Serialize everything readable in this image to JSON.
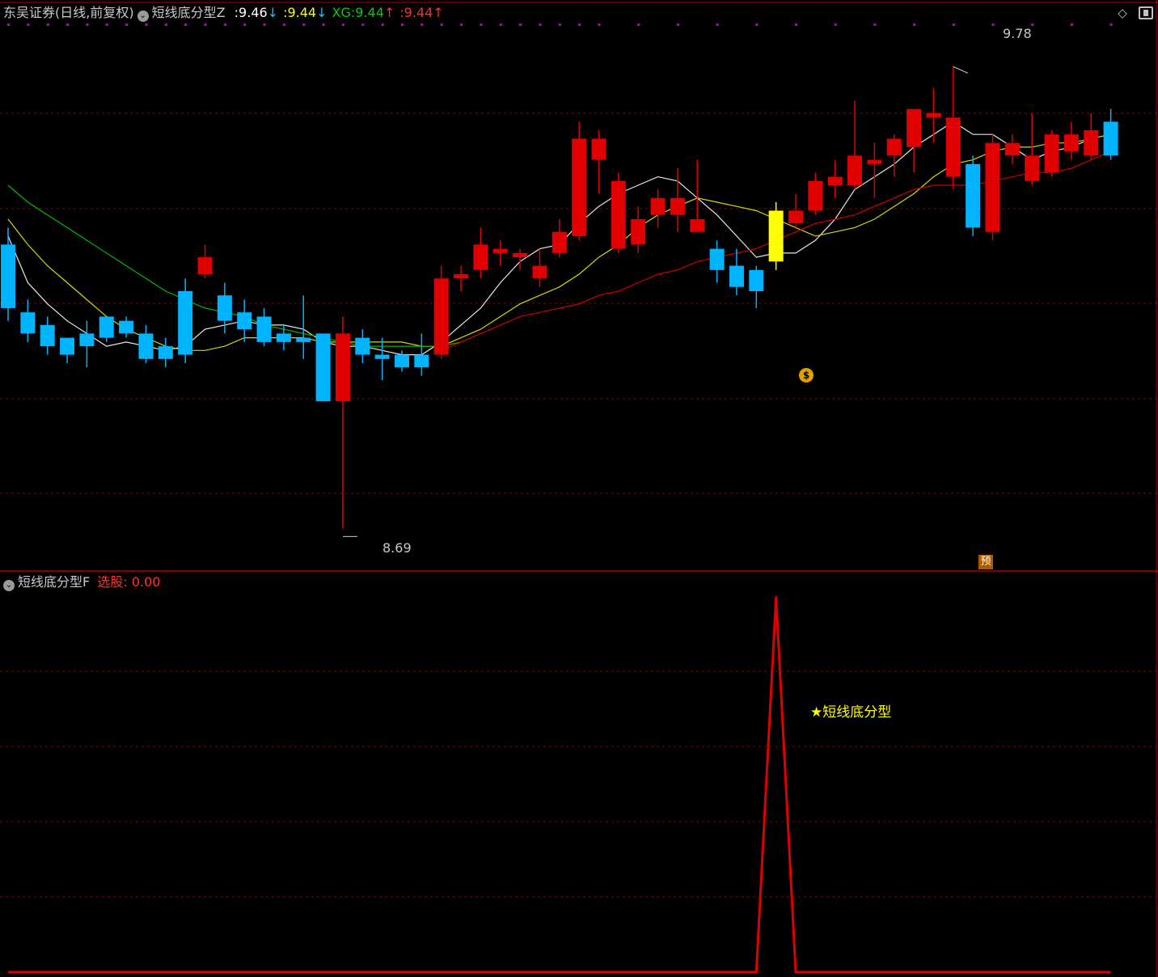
{
  "header": {
    "broker": "东吴证券",
    "period": "(日线,前复权)",
    "indicator_name": "短线底分型Z",
    "values": [
      {
        "label": ":",
        "value": "9.46",
        "arrow": "↓",
        "color": "#ffffff",
        "arrow_color": "#00c8ff"
      },
      {
        "label": ":",
        "value": "9.44",
        "arrow": "↓",
        "color": "#ffff00",
        "arrow_color": "#00c8ff"
      },
      {
        "label": "XG:",
        "value": "9.44",
        "arrow": "↑",
        "color": "#00d000",
        "arrow_color": "#ff3030"
      },
      {
        "label": ":",
        "value": "9.44",
        "arrow": "↑",
        "color": "#ff3030",
        "arrow_color": "#ff3030"
      }
    ],
    "chevron_icon": "chevron-down-icon",
    "diamond_icon": "diamond-icon",
    "window_icon": "maximize-icon"
  },
  "sub_header": {
    "indicator_name": "短线底分型F",
    "label": "选股",
    "value": "0.00"
  },
  "annotations": {
    "high_label": "9.78",
    "low_label": "8.69",
    "signal_text": "短线底分型",
    "star": "★",
    "yu_badge": "预",
    "money_bag": "$"
  },
  "colors": {
    "up": "#e00000",
    "down": "#00b4ff",
    "signal": "#ffff00",
    "ma_white": "#e8e8e8",
    "ma_yellow": "#d8d800",
    "ma_green": "#00b800",
    "ma_red": "#d00000",
    "grid": "#8a0000",
    "separator": "#b00000",
    "dots": "#c000c0"
  },
  "chart_data": [
    {
      "type": "candlestick",
      "title": "",
      "ylim": [
        8.62,
        9.88
      ],
      "high_marker": 9.78,
      "low_marker": 8.69,
      "bars": [
        {
          "o": 9.36,
          "h": 9.4,
          "l": 9.18,
          "c": 9.21,
          "s": "down"
        },
        {
          "o": 9.2,
          "h": 9.23,
          "l": 9.13,
          "c": 9.15,
          "s": "down"
        },
        {
          "o": 9.17,
          "h": 9.19,
          "l": 9.1,
          "c": 9.12,
          "s": "down"
        },
        {
          "o": 9.14,
          "h": 9.14,
          "l": 9.08,
          "c": 9.1,
          "s": "down"
        },
        {
          "o": 9.15,
          "h": 9.18,
          "l": 9.07,
          "c": 9.12,
          "s": "down"
        },
        {
          "o": 9.19,
          "h": 9.19,
          "l": 9.13,
          "c": 9.14,
          "s": "down"
        },
        {
          "o": 9.18,
          "h": 9.19,
          "l": 9.14,
          "c": 9.15,
          "s": "down"
        },
        {
          "o": 9.15,
          "h": 9.17,
          "l": 9.08,
          "c": 9.09,
          "s": "down"
        },
        {
          "o": 9.12,
          "h": 9.14,
          "l": 9.07,
          "c": 9.09,
          "s": "down"
        },
        {
          "o": 9.25,
          "h": 9.28,
          "l": 9.08,
          "c": 9.1,
          "s": "down"
        },
        {
          "o": 9.29,
          "h": 9.36,
          "l": 9.28,
          "c": 9.33,
          "s": "up"
        },
        {
          "o": 9.24,
          "h": 9.27,
          "l": 9.15,
          "c": 9.18,
          "s": "down"
        },
        {
          "o": 9.2,
          "h": 9.23,
          "l": 9.13,
          "c": 9.16,
          "s": "down"
        },
        {
          "o": 9.19,
          "h": 9.21,
          "l": 9.12,
          "c": 9.13,
          "s": "down"
        },
        {
          "o": 9.15,
          "h": 9.17,
          "l": 9.11,
          "c": 9.13,
          "s": "down"
        },
        {
          "o": 9.14,
          "h": 9.24,
          "l": 9.09,
          "c": 9.13,
          "s": "down"
        },
        {
          "o": 9.15,
          "h": 9.15,
          "l": 8.99,
          "c": 8.99,
          "s": "down"
        },
        {
          "o": 8.99,
          "h": 9.19,
          "l": 8.69,
          "c": 9.15,
          "s": "up"
        },
        {
          "o": 9.14,
          "h": 9.16,
          "l": 9.08,
          "c": 9.1,
          "s": "down"
        },
        {
          "o": 9.1,
          "h": 9.14,
          "l": 9.04,
          "c": 9.09,
          "s": "down"
        },
        {
          "o": 9.1,
          "h": 9.11,
          "l": 9.06,
          "c": 9.07,
          "s": "down"
        },
        {
          "o": 9.1,
          "h": 9.15,
          "l": 9.05,
          "c": 9.07,
          "s": "down"
        },
        {
          "o": 9.1,
          "h": 9.31,
          "l": 9.09,
          "c": 9.28,
          "s": "up"
        },
        {
          "o": 9.28,
          "h": 9.31,
          "l": 9.25,
          "c": 9.29,
          "s": "up"
        },
        {
          "o": 9.3,
          "h": 9.4,
          "l": 9.28,
          "c": 9.36,
          "s": "up"
        },
        {
          "o": 9.34,
          "h": 9.37,
          "l": 9.31,
          "c": 9.35,
          "s": "up"
        },
        {
          "o": 9.33,
          "h": 9.35,
          "l": 9.3,
          "c": 9.34,
          "s": "up"
        },
        {
          "o": 9.28,
          "h": 9.35,
          "l": 9.26,
          "c": 9.31,
          "s": "up"
        },
        {
          "o": 9.34,
          "h": 9.42,
          "l": 9.33,
          "c": 9.39,
          "s": "up"
        },
        {
          "o": 9.38,
          "h": 9.65,
          "l": 9.37,
          "c": 9.61,
          "s": "up"
        },
        {
          "o": 9.56,
          "h": 9.63,
          "l": 9.48,
          "c": 9.61,
          "s": "up"
        },
        {
          "o": 9.35,
          "h": 9.53,
          "l": 9.34,
          "c": 9.51,
          "s": "up"
        },
        {
          "o": 9.36,
          "h": 9.45,
          "l": 9.34,
          "c": 9.42,
          "s": "up"
        },
        {
          "o": 9.43,
          "h": 9.49,
          "l": 9.4,
          "c": 9.47,
          "s": "up"
        },
        {
          "o": 9.43,
          "h": 9.54,
          "l": 9.39,
          "c": 9.47,
          "s": "up"
        },
        {
          "o": 9.39,
          "h": 9.56,
          "l": 9.39,
          "c": 9.42,
          "s": "up"
        },
        {
          "o": 9.35,
          "h": 9.37,
          "l": 9.27,
          "c": 9.3,
          "s": "down"
        },
        {
          "o": 9.31,
          "h": 9.35,
          "l": 9.24,
          "c": 9.26,
          "s": "down"
        },
        {
          "o": 9.3,
          "h": 9.31,
          "l": 9.21,
          "c": 9.25,
          "s": "down"
        },
        {
          "o": 9.32,
          "h": 9.46,
          "l": 9.3,
          "c": 9.44,
          "s": "signal"
        },
        {
          "o": 9.41,
          "h": 9.48,
          "l": 9.4,
          "c": 9.44,
          "s": "up"
        },
        {
          "o": 9.44,
          "h": 9.53,
          "l": 9.43,
          "c": 9.51,
          "s": "up"
        },
        {
          "o": 9.5,
          "h": 9.56,
          "l": 9.47,
          "c": 9.52,
          "s": "up"
        },
        {
          "o": 9.5,
          "h": 9.7,
          "l": 9.49,
          "c": 9.57,
          "s": "up"
        },
        {
          "o": 9.55,
          "h": 9.6,
          "l": 9.47,
          "c": 9.56,
          "s": "up"
        },
        {
          "o": 9.57,
          "h": 9.62,
          "l": 9.52,
          "c": 9.61,
          "s": "up"
        },
        {
          "o": 9.59,
          "h": 9.68,
          "l": 9.53,
          "c": 9.68,
          "s": "up"
        },
        {
          "o": 9.66,
          "h": 9.73,
          "l": 9.6,
          "c": 9.67,
          "s": "up"
        },
        {
          "o": 9.52,
          "h": 9.78,
          "l": 9.49,
          "c": 9.66,
          "s": "up"
        },
        {
          "o": 9.55,
          "h": 9.57,
          "l": 9.38,
          "c": 9.4,
          "s": "down"
        },
        {
          "o": 9.39,
          "h": 9.62,
          "l": 9.37,
          "c": 9.6,
          "s": "up"
        },
        {
          "o": 9.57,
          "h": 9.62,
          "l": 9.55,
          "c": 9.6,
          "s": "up"
        },
        {
          "o": 9.51,
          "h": 9.67,
          "l": 9.5,
          "c": 9.57,
          "s": "up"
        },
        {
          "o": 9.53,
          "h": 9.63,
          "l": 9.52,
          "c": 9.62,
          "s": "up"
        },
        {
          "o": 9.58,
          "h": 9.65,
          "l": 9.56,
          "c": 9.62,
          "s": "up"
        },
        {
          "o": 9.57,
          "h": 9.67,
          "l": 9.56,
          "c": 9.63,
          "s": "up"
        },
        {
          "o": 9.57,
          "h": 9.68,
          "l": 9.56,
          "c": 9.65,
          "s": "down"
        }
      ],
      "ma_lines": [
        {
          "name": "MA5",
          "color": "#e8e8e8",
          "values": [
            9.38,
            9.27,
            9.22,
            9.18,
            9.15,
            9.12,
            9.13,
            9.12,
            9.11,
            9.12,
            9.16,
            9.17,
            9.18,
            9.17,
            9.17,
            9.16,
            9.13,
            9.12,
            9.12,
            9.11,
            9.1,
            9.1,
            9.13,
            9.17,
            9.21,
            9.27,
            9.32,
            9.35,
            9.36,
            9.41,
            9.45,
            9.48,
            9.5,
            9.52,
            9.51,
            9.47,
            9.43,
            9.38,
            9.33,
            9.34,
            9.34,
            9.37,
            9.42,
            9.49,
            9.52,
            9.55,
            9.59,
            9.62,
            9.65,
            9.62,
            9.62,
            9.59,
            9.56,
            9.58,
            9.59,
            9.61,
            9.62
          ]
        },
        {
          "name": "MA10",
          "color": "#d8d800",
          "values": [
            9.42,
            9.36,
            9.31,
            9.27,
            9.23,
            9.19,
            9.16,
            9.14,
            9.12,
            9.11,
            9.11,
            9.12,
            9.14,
            9.14,
            9.14,
            9.14,
            9.13,
            9.13,
            9.13,
            9.13,
            9.13,
            9.12,
            9.12,
            9.14,
            9.16,
            9.19,
            9.22,
            9.24,
            9.26,
            9.29,
            9.33,
            9.36,
            9.4,
            9.43,
            9.45,
            9.47,
            9.46,
            9.45,
            9.44,
            9.42,
            9.4,
            9.38,
            9.39,
            9.4,
            9.42,
            9.45,
            9.48,
            9.52,
            9.55,
            9.56,
            9.58,
            9.59,
            9.59,
            9.6,
            9.6,
            9.61,
            9.62
          ]
        },
        {
          "name": "MA20",
          "color": "#00b800",
          "values": [
            9.5,
            9.46,
            9.43,
            9.4,
            9.37,
            9.34,
            9.31,
            9.28,
            9.25,
            9.23,
            9.21,
            9.2,
            9.19,
            9.17,
            9.16,
            9.15,
            9.14,
            9.13,
            9.12,
            9.12,
            9.12,
            9.12,
            9.12,
            9.13
          ]
        },
        {
          "name": "MA60",
          "color": "#d00000",
          "values": [
            null,
            null,
            null,
            null,
            null,
            null,
            null,
            null,
            null,
            null,
            null,
            null,
            null,
            null,
            null,
            null,
            null,
            null,
            null,
            null,
            null,
            null,
            9.11,
            9.13,
            9.15,
            9.17,
            9.19,
            9.2,
            9.21,
            9.22,
            9.24,
            9.25,
            9.27,
            9.29,
            9.3,
            9.32,
            9.33,
            9.34,
            9.35,
            9.37,
            9.39,
            9.41,
            9.42,
            9.43,
            9.45,
            9.47,
            9.49,
            9.5,
            9.5,
            9.5,
            9.51,
            9.52,
            9.53,
            9.53,
            9.54,
            9.56,
            9.58
          ]
        }
      ]
    },
    {
      "type": "line",
      "title": "",
      "ylim": [
        0,
        1
      ],
      "series": [
        {
          "name": "选股",
          "color": "#e00000",
          "values": [
            0,
            0,
            0,
            0,
            0,
            0,
            0,
            0,
            0,
            0,
            0,
            0,
            0,
            0,
            0,
            0,
            0,
            0,
            0,
            0,
            0,
            0,
            0,
            0,
            0,
            0,
            0,
            0,
            0,
            0,
            0,
            0,
            0,
            0,
            0,
            0,
            0,
            0,
            0,
            1,
            0,
            0,
            0,
            0,
            0,
            0,
            0,
            0,
            0,
            0,
            0,
            0,
            0,
            0,
            0,
            0,
            0
          ]
        }
      ]
    }
  ]
}
